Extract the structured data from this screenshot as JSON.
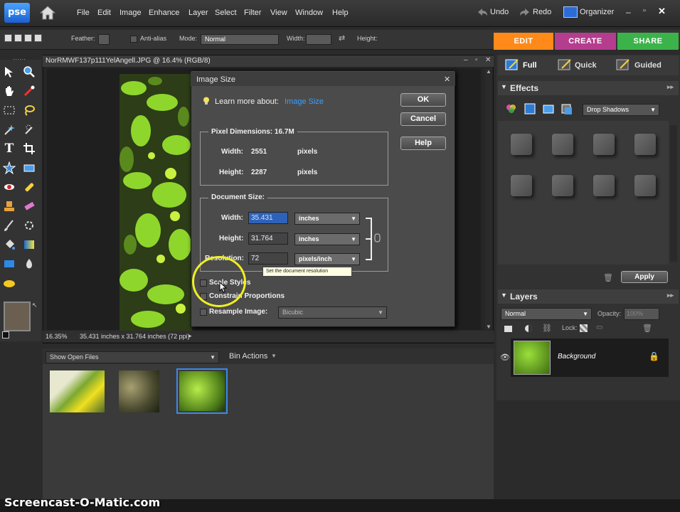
{
  "app": {
    "logo_text": "pse"
  },
  "menu": {
    "items": [
      "File",
      "Edit",
      "Image",
      "Enhance",
      "Layer",
      "Select",
      "Filter",
      "View",
      "Window",
      "Help"
    ]
  },
  "history": {
    "undo": "Undo",
    "redo": "Redo",
    "organizer": "Organizer"
  },
  "options": {
    "feather": "Feather:",
    "anti_alias": "Anti-alias",
    "mode": "Mode:",
    "mode_value": "Normal",
    "width": "Width:",
    "height": "Height:"
  },
  "tabs": [
    {
      "label": "EDIT",
      "color": "#ff8a1a"
    },
    {
      "label": "CREATE",
      "color": "#b53d8e"
    },
    {
      "label": "SHARE",
      "color": "#3cb34a"
    }
  ],
  "edit_modes": [
    "Full",
    "Quick",
    "Guided"
  ],
  "document": {
    "title": "NorRMWF137p111YelAngell.JPG @ 16.4% (RGB/8)",
    "zoom": "16.35%",
    "status": "35.431 inches x 31.764 inches (72 ppi)"
  },
  "dialog": {
    "title": "Image Size",
    "learn_more": "Learn more about:",
    "learn_link": "Image Size",
    "ok": "OK",
    "cancel": "Cancel",
    "help": "Help",
    "pixel_dimensions": "Pixel Dimensions: 16.7M",
    "px_width_label": "Width:",
    "px_width": "2551",
    "px_width_unit": "pixels",
    "px_height_label": "Height:",
    "px_height": "2287",
    "px_height_unit": "pixels",
    "document_size": "Document Size:",
    "doc_width_label": "Width:",
    "doc_width": "35.431",
    "doc_width_unit": "inches",
    "doc_height_label": "Height:",
    "doc_height": "31.764",
    "doc_height_unit": "inches",
    "res_label": "Resolution:",
    "resolution": "72",
    "res_unit": "pixels/inch",
    "tooltip": "Set the document resolution",
    "scale_styles": "Scale Styles",
    "constrain": "Constrain Proportions",
    "resample": "Resample Image:",
    "resample_value": "Bicubic"
  },
  "effects": {
    "title": "Effects",
    "dropdown": "Drop Shadows",
    "apply": "Apply"
  },
  "layers": {
    "title": "Layers",
    "blend": "Normal",
    "opacity_label": "Opacity:",
    "opacity": "100%",
    "lock": "Lock:",
    "layer_name": "Background"
  },
  "bin": {
    "show": "Show Open Files",
    "actions": "Bin Actions"
  },
  "watermark": "Screencast-O-Matic.com"
}
